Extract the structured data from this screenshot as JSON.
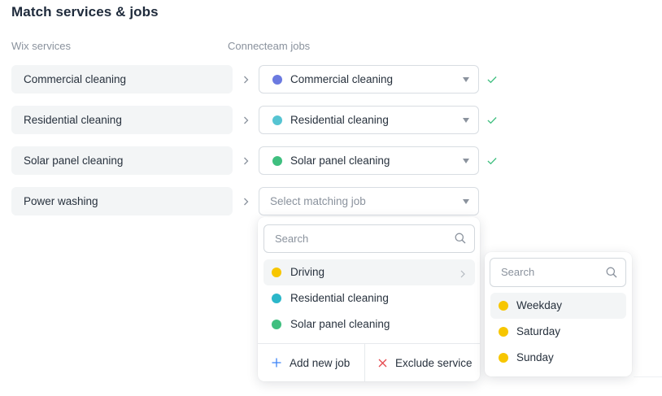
{
  "page": {
    "title": "Match services & jobs"
  },
  "columns": {
    "wix": "Wix services",
    "connecteam": "Connecteam jobs"
  },
  "rows": [
    {
      "service": "Commercial cleaning",
      "job": "Commercial cleaning",
      "dot_color": "#6b7ae0",
      "matched": true
    },
    {
      "service": "Residential cleaning",
      "job": "Residential cleaning",
      "dot_color": "#56c4d2",
      "matched": true
    },
    {
      "service": "Solar panel cleaning",
      "job": "Solar panel cleaning",
      "dot_color": "#3fbf7f",
      "matched": true
    },
    {
      "service": "Power washing",
      "job": "",
      "placeholder": "Select matching job",
      "matched": false
    }
  ],
  "dropdown": {
    "search_placeholder": "Search",
    "options": [
      {
        "label": "Driving",
        "dot_color": "#f7c600",
        "has_submenu": true,
        "highlighted": true
      },
      {
        "label": "Residential cleaning",
        "dot_color": "#2bb7c9",
        "has_submenu": false,
        "highlighted": false
      },
      {
        "label": "Solar panel cleaning",
        "dot_color": "#3fbf7f",
        "has_submenu": false,
        "highlighted": false
      }
    ],
    "add_label": "Add new job",
    "exclude_label": "Exclude service"
  },
  "submenu": {
    "search_placeholder": "Search",
    "options": [
      {
        "label": "Weekday",
        "dot_color": "#f7c600",
        "highlighted": true
      },
      {
        "label": "Saturday",
        "dot_color": "#f7c600",
        "highlighted": false
      },
      {
        "label": "Sunday",
        "dot_color": "#f7c600",
        "highlighted": false
      }
    ]
  },
  "colors": {
    "accent": "#3b82f6",
    "check": "#3fbf7f",
    "danger": "#e5484d"
  }
}
